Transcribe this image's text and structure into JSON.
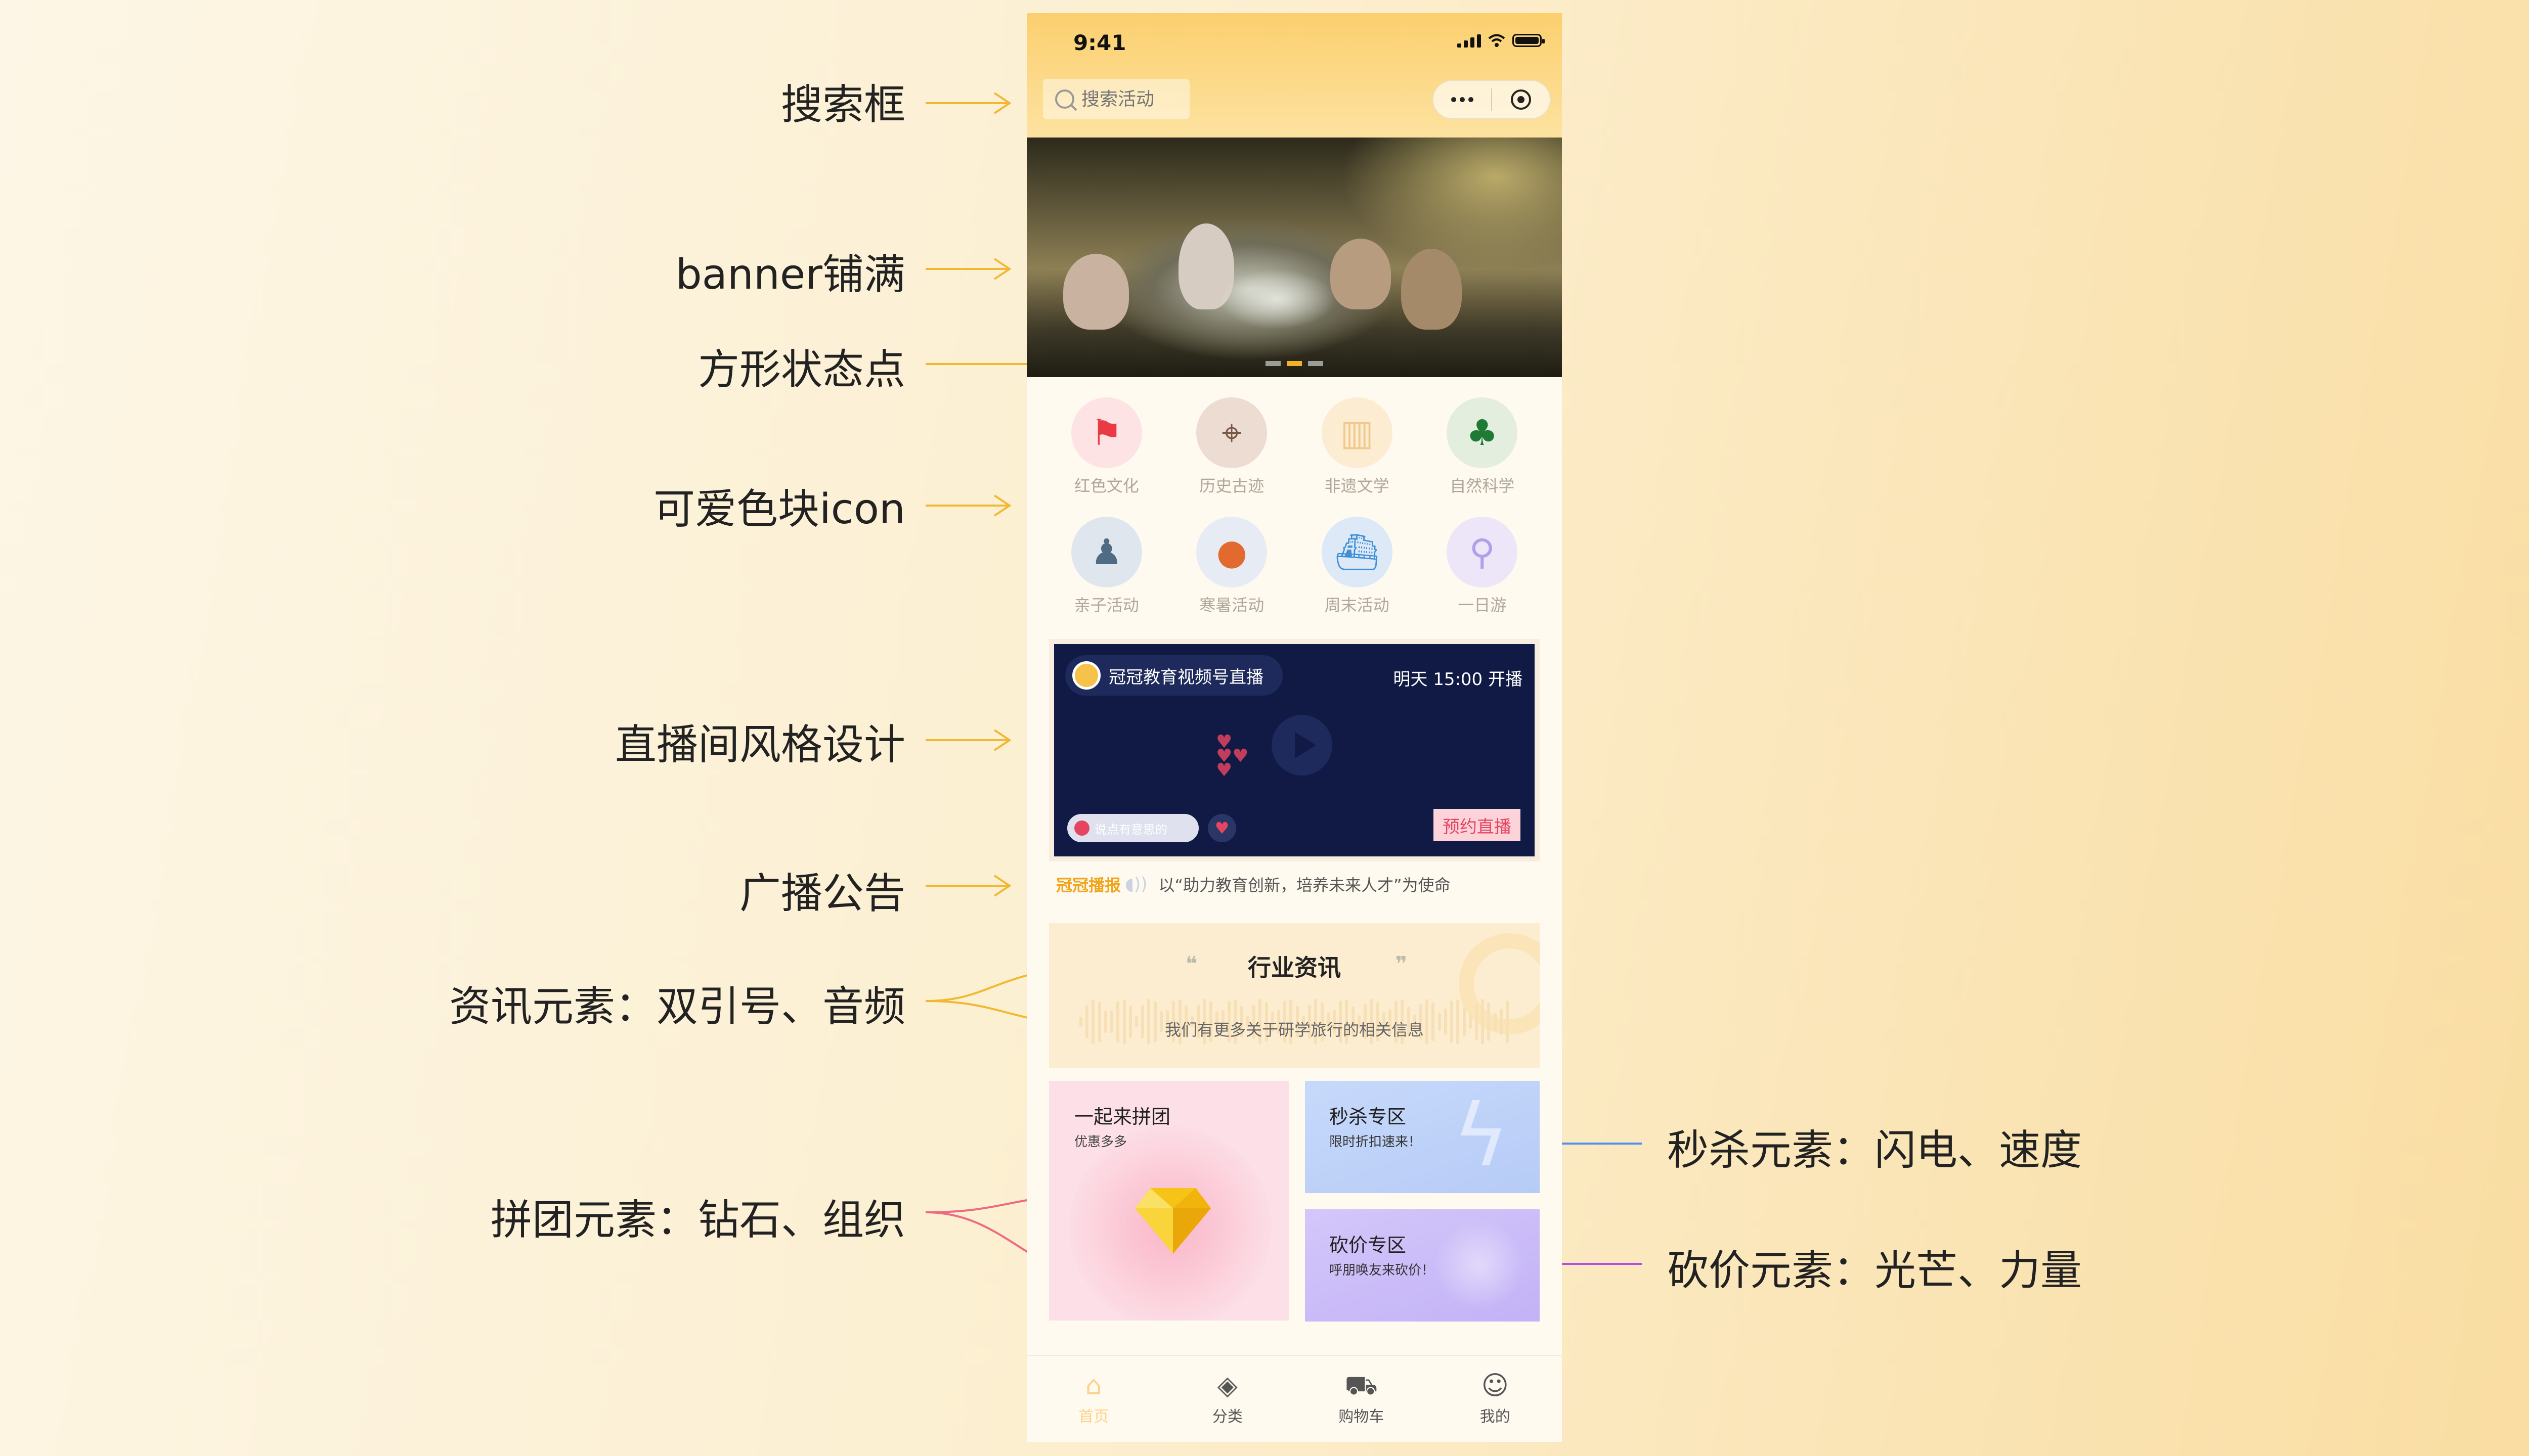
{
  "annotations": {
    "search": "搜索框",
    "banner": "banner铺满",
    "dots": "方形状态点",
    "icon": "可爱色块icon",
    "live": "直播间风格设计",
    "notice": "广播公告",
    "news": "资讯元素：双引号、音频",
    "group": "拼团元素：钻石、组织",
    "flash": "秒杀元素：闪电、速度",
    "bargain": "砍价元素：光芒、力量"
  },
  "status": {
    "time": "9:41"
  },
  "search": {
    "placeholder": "搜索活动"
  },
  "categories": [
    {
      "label": "红色文化",
      "icon": "red-flag-icon"
    },
    {
      "label": "历史古迹",
      "icon": "map-pin-icon"
    },
    {
      "label": "非遗文学",
      "icon": "book-icon"
    },
    {
      "label": "自然科学",
      "icon": "palm-tree-icon"
    },
    {
      "label": "亲子活动",
      "icon": "family-icon"
    },
    {
      "label": "寒暑活动",
      "icon": "balloon-icon"
    },
    {
      "label": "周末活动",
      "icon": "ship-icon"
    },
    {
      "label": "一日游",
      "icon": "bicycle-icon"
    }
  ],
  "live": {
    "channel": "冠冠教育视频号直播",
    "time": "明天 15:00 开播",
    "comment_placeholder": "说点有意思的",
    "book_label": "预约直播"
  },
  "notice": {
    "title": "冠冠播报",
    "text": "以“助力教育创新，培养未来人才”为使命"
  },
  "news": {
    "title": "行业资讯",
    "subtitle": "我们有更多关于研学旅行的相关信息"
  },
  "promos": {
    "group": {
      "title": "一起来拼团",
      "subtitle": "优惠多多"
    },
    "flash": {
      "title": "秒杀专区",
      "subtitle": "限时折扣速来！"
    },
    "bargain": {
      "title": "砍价专区",
      "subtitle": "呼朋唤友来砍价！"
    }
  },
  "tabs": [
    {
      "label": "首页",
      "icon": "home-icon",
      "active": true
    },
    {
      "label": "分类",
      "icon": "layers-icon",
      "active": false
    },
    {
      "label": "购物车",
      "icon": "cart-icon",
      "active": false
    },
    {
      "label": "我的",
      "icon": "user-icon",
      "active": false
    }
  ],
  "banner": {
    "dots": 3,
    "active_dot": 1
  },
  "colors": {
    "accent": "#F5B125",
    "live_bg": "#101A45",
    "live_red": "#E54561"
  }
}
